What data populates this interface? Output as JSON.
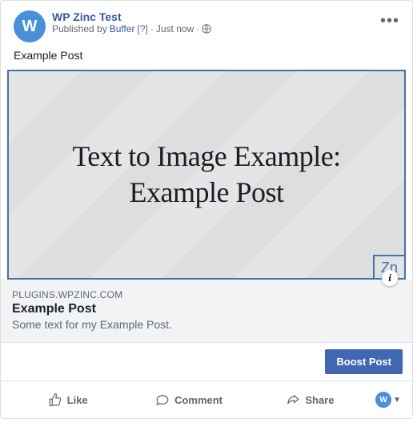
{
  "header": {
    "avatar_letter": "W",
    "page_name": "WP Zinc Test",
    "published_prefix": "Published by",
    "publisher": "Buffer",
    "question_mark": "[?]",
    "separator": "·",
    "time": "Just now"
  },
  "content": {
    "text": "Example Post"
  },
  "image": {
    "line1": "Text to Image Example:",
    "line2": "Example Post",
    "badge": "Zn"
  },
  "link": {
    "domain": "PLUGINS.WPZINC.COM",
    "title": "Example Post",
    "description": "Some text for my Example Post."
  },
  "boost": {
    "label": "Boost Post"
  },
  "actions": {
    "like": "Like",
    "comment": "Comment",
    "share": "Share"
  },
  "profile": {
    "letter": "W"
  },
  "more_glyph": "•••",
  "info_glyph": "i"
}
